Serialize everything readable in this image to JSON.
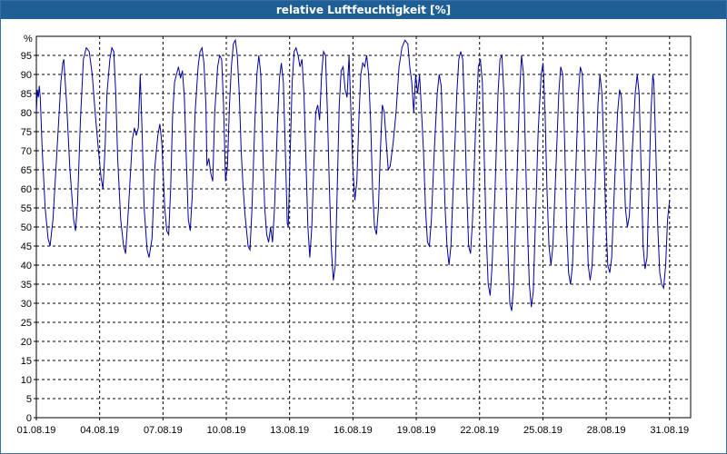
{
  "window": {
    "title": "relative Luftfeuchtigkeit [%]",
    "colors": {
      "title_bar": "#1f5f95",
      "title_text": "#ffffff",
      "series_line": "#0000a0",
      "grid": "#000000"
    }
  },
  "chart_data": {
    "type": "line",
    "title": "relative Luftfeuchtigkeit [%]",
    "ylabel": "%",
    "xlabel": "",
    "ylim": [
      0,
      100
    ],
    "grid": true,
    "y_ticks": [
      "0",
      "5",
      "10",
      "15",
      "20",
      "25",
      "30",
      "35",
      "40",
      "45",
      "50",
      "55",
      "60",
      "65",
      "70",
      "75",
      "80",
      "85",
      "90",
      "95"
    ],
    "x_ticks": [
      "01.08.19",
      "04.08.19",
      "07.08.19",
      "10.08.19",
      "13.08.19",
      "16.08.19",
      "19.08.19",
      "22.08.19",
      "25.08.19",
      "28.08.19",
      "31.08.19"
    ],
    "x_range_days": [
      0,
      31
    ],
    "series": [
      {
        "points": [
          [
            0.0,
            80
          ],
          [
            0.05,
            86
          ],
          [
            0.1,
            84
          ],
          [
            0.15,
            87
          ],
          [
            0.2,
            84
          ],
          [
            0.3,
            70
          ],
          [
            0.45,
            55
          ],
          [
            0.6,
            47
          ],
          [
            0.7,
            45
          ],
          [
            0.85,
            52
          ],
          [
            1.05,
            70
          ],
          [
            1.25,
            88
          ],
          [
            1.35,
            93
          ],
          [
            1.4,
            94
          ],
          [
            1.55,
            82
          ],
          [
            1.7,
            66
          ],
          [
            1.8,
            59
          ],
          [
            1.9,
            52
          ],
          [
            2.0,
            49
          ],
          [
            2.1,
            56
          ],
          [
            2.25,
            78
          ],
          [
            2.4,
            94
          ],
          [
            2.55,
            97
          ],
          [
            2.7,
            96
          ],
          [
            2.85,
            90
          ],
          [
            3.0,
            80
          ],
          [
            3.15,
            71
          ],
          [
            3.3,
            63
          ],
          [
            3.4,
            60
          ],
          [
            3.5,
            70
          ],
          [
            3.6,
            85
          ],
          [
            3.75,
            94
          ],
          [
            3.85,
            97
          ],
          [
            3.95,
            96
          ],
          [
            4.05,
            85
          ],
          [
            4.15,
            68
          ],
          [
            4.3,
            52
          ],
          [
            4.45,
            45
          ],
          [
            4.55,
            43
          ],
          [
            4.7,
            55
          ],
          [
            4.9,
            73
          ],
          [
            5.0,
            76
          ],
          [
            5.1,
            74
          ],
          [
            5.2,
            76
          ],
          [
            5.3,
            90
          ],
          [
            5.4,
            74
          ],
          [
            5.5,
            55
          ],
          [
            5.65,
            44
          ],
          [
            5.75,
            42
          ],
          [
            5.9,
            47
          ],
          [
            6.05,
            66
          ],
          [
            6.2,
            74
          ],
          [
            6.3,
            77
          ],
          [
            6.4,
            72
          ],
          [
            6.55,
            55
          ],
          [
            6.65,
            49
          ],
          [
            6.75,
            48
          ],
          [
            6.85,
            60
          ],
          [
            6.95,
            79
          ],
          [
            7.05,
            88
          ],
          [
            7.15,
            90
          ],
          [
            7.25,
            92
          ],
          [
            7.35,
            89
          ],
          [
            7.45,
            91
          ],
          [
            7.55,
            84
          ],
          [
            7.65,
            68
          ],
          [
            7.75,
            52
          ],
          [
            7.85,
            49
          ],
          [
            7.95,
            58
          ],
          [
            8.1,
            80
          ],
          [
            8.25,
            92
          ],
          [
            8.35,
            96
          ],
          [
            8.45,
            97
          ],
          [
            8.55,
            93
          ],
          [
            8.65,
            82
          ],
          [
            8.7,
            66
          ],
          [
            8.8,
            68
          ],
          [
            8.9,
            64
          ],
          [
            9.0,
            62
          ],
          [
            9.1,
            80
          ],
          [
            9.25,
            92
          ],
          [
            9.35,
            95
          ],
          [
            9.45,
            94
          ],
          [
            9.55,
            82
          ],
          [
            9.65,
            62
          ],
          [
            9.75,
            66
          ],
          [
            9.85,
            82
          ],
          [
            9.95,
            92
          ],
          [
            10.05,
            98
          ],
          [
            10.15,
            99
          ],
          [
            10.25,
            95
          ],
          [
            10.35,
            85
          ],
          [
            10.45,
            70
          ],
          [
            10.55,
            60
          ],
          [
            10.65,
            53
          ],
          [
            10.8,
            45
          ],
          [
            10.9,
            44
          ],
          [
            11.0,
            55
          ],
          [
            11.15,
            78
          ],
          [
            11.25,
            90
          ],
          [
            11.35,
            95
          ],
          [
            11.45,
            90
          ],
          [
            11.55,
            70
          ],
          [
            11.65,
            55
          ],
          [
            11.75,
            48
          ],
          [
            11.85,
            46
          ],
          [
            11.95,
            50
          ],
          [
            12.05,
            46
          ],
          [
            12.15,
            55
          ],
          [
            12.3,
            77
          ],
          [
            12.4,
            89
          ],
          [
            12.5,
            93
          ],
          [
            12.6,
            88
          ],
          [
            12.7,
            70
          ],
          [
            12.8,
            51
          ],
          [
            12.85,
            50
          ],
          [
            12.95,
            70
          ],
          [
            13.05,
            88
          ],
          [
            13.15,
            96
          ],
          [
            13.25,
            97
          ],
          [
            13.35,
            95
          ],
          [
            13.45,
            92
          ],
          [
            13.55,
            94
          ],
          [
            13.65,
            85
          ],
          [
            13.75,
            68
          ],
          [
            13.85,
            50
          ],
          [
            13.95,
            42
          ],
          [
            14.05,
            50
          ],
          [
            14.15,
            65
          ],
          [
            14.25,
            80
          ],
          [
            14.35,
            82
          ],
          [
            14.45,
            78
          ],
          [
            14.55,
            90
          ],
          [
            14.65,
            96
          ],
          [
            14.75,
            95
          ],
          [
            14.85,
            80
          ],
          [
            14.95,
            60
          ],
          [
            15.05,
            44
          ],
          [
            15.15,
            36
          ],
          [
            15.25,
            40
          ],
          [
            15.35,
            60
          ],
          [
            15.45,
            82
          ],
          [
            15.55,
            91
          ],
          [
            15.65,
            92
          ],
          [
            15.75,
            86
          ],
          [
            15.85,
            84
          ],
          [
            15.95,
            95
          ],
          [
            16.05,
            80
          ],
          [
            16.15,
            65
          ],
          [
            16.25,
            57
          ],
          [
            16.35,
            62
          ],
          [
            16.45,
            78
          ],
          [
            16.55,
            90
          ],
          [
            16.65,
            93
          ],
          [
            16.75,
            92
          ],
          [
            16.85,
            95
          ],
          [
            16.95,
            90
          ],
          [
            17.05,
            78
          ],
          [
            17.15,
            60
          ],
          [
            17.25,
            50
          ],
          [
            17.35,
            48
          ],
          [
            17.45,
            55
          ],
          [
            17.55,
            70
          ],
          [
            17.65,
            82
          ],
          [
            17.75,
            80
          ],
          [
            17.85,
            72
          ],
          [
            17.95,
            65
          ],
          [
            18.05,
            66
          ],
          [
            18.2,
            72
          ],
          [
            18.35,
            80
          ],
          [
            18.5,
            92
          ],
          [
            18.65,
            97
          ],
          [
            18.8,
            99
          ],
          [
            18.95,
            98
          ],
          [
            19.05,
            92
          ],
          [
            19.15,
            88
          ],
          [
            19.25,
            80
          ],
          [
            19.35,
            90
          ],
          [
            19.45,
            85
          ],
          [
            19.55,
            90
          ],
          [
            19.65,
            80
          ],
          [
            19.75,
            70
          ],
          [
            19.85,
            55
          ],
          [
            19.95,
            46
          ],
          [
            20.05,
            45
          ],
          [
            20.15,
            52
          ],
          [
            20.3,
            70
          ],
          [
            20.45,
            85
          ],
          [
            20.55,
            90
          ],
          [
            20.65,
            87
          ],
          [
            20.75,
            72
          ],
          [
            20.85,
            55
          ],
          [
            20.95,
            45
          ],
          [
            21.05,
            40
          ],
          [
            21.15,
            45
          ],
          [
            21.3,
            65
          ],
          [
            21.45,
            85
          ],
          [
            21.55,
            94
          ],
          [
            21.65,
            96
          ],
          [
            21.75,
            94
          ],
          [
            21.85,
            80
          ],
          [
            21.95,
            60
          ],
          [
            22.05,
            45
          ],
          [
            22.15,
            43
          ],
          [
            22.25,
            52
          ],
          [
            22.4,
            75
          ],
          [
            22.55,
            92
          ],
          [
            22.65,
            94
          ],
          [
            22.75,
            88
          ],
          [
            22.85,
            68
          ],
          [
            22.95,
            48
          ],
          [
            23.05,
            35
          ],
          [
            23.15,
            32
          ],
          [
            23.25,
            40
          ],
          [
            23.4,
            60
          ],
          [
            23.55,
            85
          ],
          [
            23.65,
            94
          ],
          [
            23.75,
            95
          ],
          [
            23.85,
            85
          ],
          [
            23.95,
            65
          ],
          [
            24.05,
            45
          ],
          [
            24.15,
            30
          ],
          [
            24.25,
            28
          ],
          [
            24.35,
            35
          ],
          [
            24.5,
            60
          ],
          [
            24.65,
            85
          ],
          [
            24.75,
            95
          ],
          [
            24.85,
            90
          ],
          [
            24.95,
            70
          ],
          [
            25.05,
            50
          ],
          [
            25.15,
            35
          ],
          [
            25.25,
            29
          ],
          [
            25.35,
            33
          ],
          [
            25.45,
            50
          ],
          [
            25.6,
            75
          ],
          [
            25.75,
            90
          ],
          [
            25.85,
            93
          ],
          [
            25.95,
            80
          ],
          [
            26.05,
            60
          ],
          [
            26.15,
            45
          ],
          [
            26.25,
            40
          ],
          [
            26.35,
            45
          ],
          [
            26.5,
            65
          ],
          [
            26.65,
            85
          ],
          [
            26.75,
            92
          ],
          [
            26.85,
            90
          ],
          [
            26.95,
            72
          ],
          [
            27.05,
            50
          ],
          [
            27.15,
            38
          ],
          [
            27.25,
            35
          ],
          [
            27.35,
            40
          ],
          [
            27.5,
            62
          ],
          [
            27.65,
            85
          ],
          [
            27.75,
            92
          ],
          [
            27.85,
            90
          ],
          [
            27.95,
            75
          ],
          [
            28.05,
            55
          ],
          [
            28.15,
            40
          ],
          [
            28.25,
            36
          ],
          [
            28.35,
            40
          ],
          [
            28.5,
            60
          ],
          [
            28.65,
            82
          ],
          [
            28.75,
            90
          ],
          [
            28.85,
            85
          ],
          [
            28.95,
            70
          ],
          [
            29.05,
            52
          ],
          [
            29.15,
            40
          ],
          [
            29.25,
            38
          ],
          [
            29.35,
            42
          ],
          [
            29.5,
            62
          ],
          [
            29.65,
            80
          ],
          [
            29.75,
            86
          ],
          [
            29.85,
            84
          ],
          [
            29.95,
            70
          ],
          [
            30.05,
            55
          ],
          [
            30.15,
            50
          ],
          [
            30.25,
            53
          ],
          [
            30.4,
            70
          ],
          [
            30.55,
            85
          ],
          [
            30.65,
            90
          ],
          [
            30.75,
            85
          ],
          [
            30.85,
            65
          ],
          [
            30.95,
            45
          ],
          [
            31.05,
            39
          ],
          [
            31.15,
            42
          ],
          [
            31.25,
            60
          ],
          [
            31.35,
            80
          ],
          [
            31.45,
            90
          ],
          [
            31.5,
            88
          ],
          [
            31.6,
            70
          ],
          [
            31.7,
            50
          ],
          [
            31.8,
            38
          ],
          [
            31.9,
            35
          ],
          [
            32.0,
            34
          ],
          [
            32.1,
            40
          ],
          [
            32.2,
            52
          ],
          [
            32.3,
            57
          ]
        ]
      }
    ]
  }
}
